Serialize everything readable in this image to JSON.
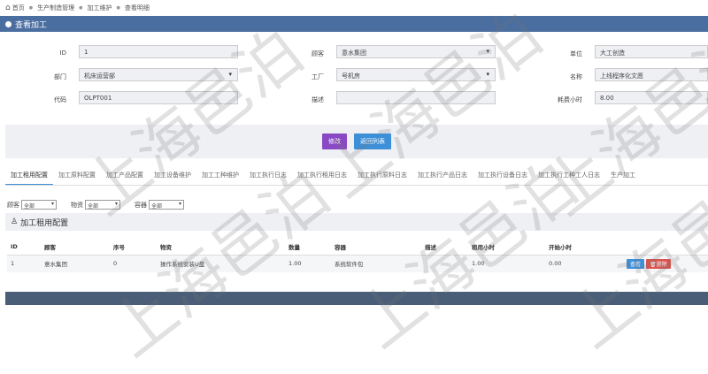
{
  "breadcrumb": [
    "首页",
    "生产制造管理",
    "加工维护",
    "查看明细"
  ],
  "panel_title": "查看加工",
  "form": {
    "id_label": "ID",
    "id_value": "1",
    "customer_label": "顾客",
    "customer_value": "意水集团",
    "unit_label": "单位",
    "unit_value": "大工创造",
    "dept_label": "部门",
    "dept_value": "机床运营部",
    "factory_label": "工厂",
    "factory_value": "号机房",
    "name_label": "名称",
    "name_value": "上线程序化文愿",
    "code_label": "代码",
    "code_value": "OLPT001",
    "desc_label": "描述",
    "desc_value": "",
    "hours_label": "耗费小时",
    "hours_value": "8.00"
  },
  "buttons": {
    "edit": "修改",
    "back": "返回列表"
  },
  "tabs": [
    "加工租用配置",
    "加工原料配置",
    "加工产品配置",
    "加工设备维护",
    "加工工种维护",
    "加工执行日志",
    "加工执行租用日志",
    "加工执行原料日志",
    "加工执行产品日志",
    "加工执行设备日志",
    "加工执行工种工人日志",
    "生产加工"
  ],
  "filters": {
    "customer_label": "顾客",
    "customer_value": "全部",
    "material_label": "物资",
    "material_value": "全部",
    "container_label": "容器",
    "container_value": "全部"
  },
  "section_title": "加工租用配置",
  "table": {
    "headers": [
      "ID",
      "顾客",
      "序号",
      "物资",
      "数量",
      "容器",
      "描述",
      "租用小时",
      "开始小时",
      ""
    ],
    "rows": [
      [
        "1",
        "意水集团",
        "0",
        "操作系统安装U盘",
        "1.00",
        "系统软件包",
        "",
        "1.00",
        "0.00"
      ]
    ],
    "view_label": "查看",
    "delete_label": "删除"
  },
  "watermark": "上海邑泊"
}
